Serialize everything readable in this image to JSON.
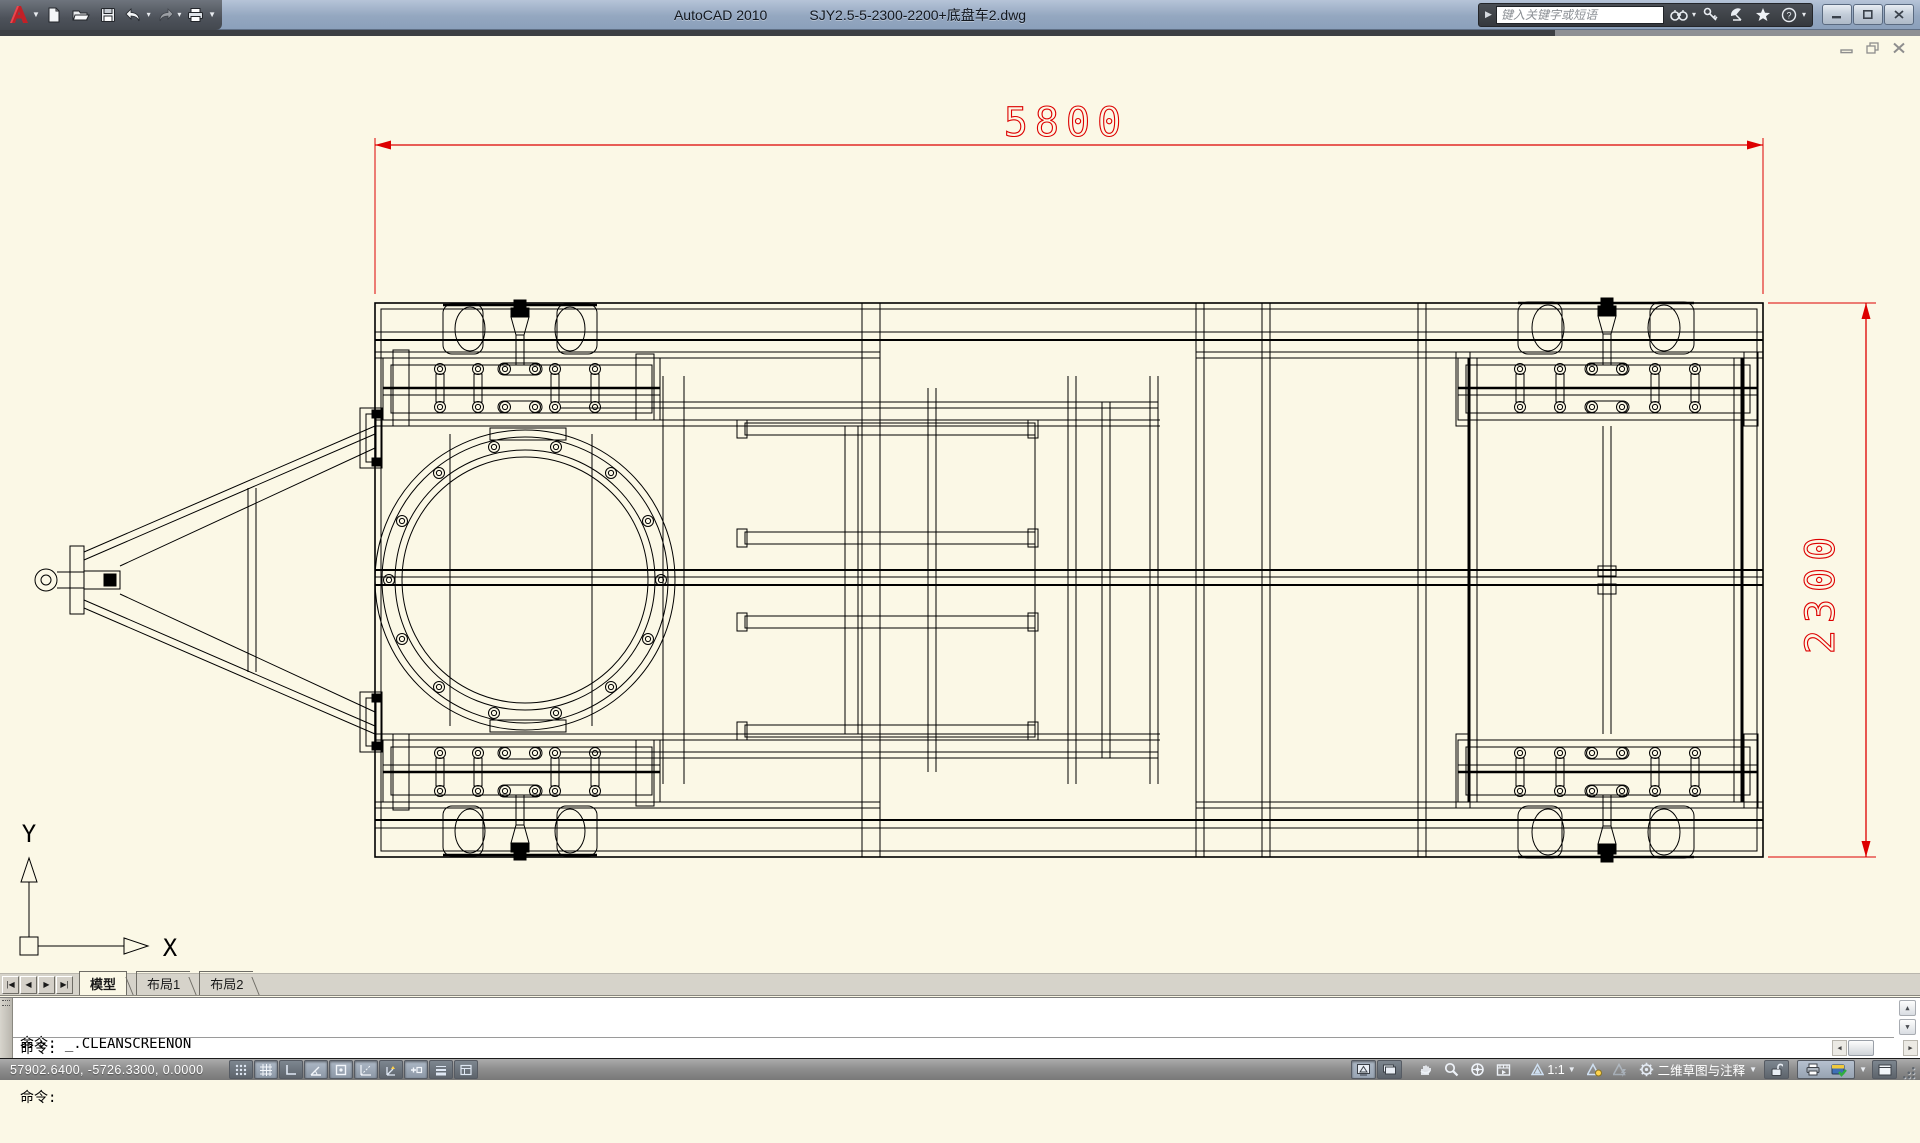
{
  "titlebar": {
    "app_title": "AutoCAD 2010",
    "doc_title": "SJY2.5-5-2300-2200+底盘车2.dwg",
    "qat_icons": [
      "autocad-logo",
      "menu-dropdown",
      "new-file",
      "open-file",
      "save",
      "undo",
      "redo",
      "plot",
      "qat-customize"
    ],
    "infocenter": {
      "search_placeholder": "键入关键字或短语",
      "icons": [
        "search-binoculars",
        "subscription-key",
        "communication-center",
        "favorites-star",
        "help"
      ]
    },
    "window_buttons": [
      "minimize",
      "maximize",
      "close"
    ]
  },
  "document_window": {
    "buttons": [
      "minimize",
      "restore",
      "close"
    ]
  },
  "drawing": {
    "dim_length": "5800",
    "dim_width": "2300",
    "dimension_color": "#dd0000",
    "ucs": {
      "x": "X",
      "y": "Y"
    }
  },
  "layout_tabs": {
    "nav_icons": [
      "first-tab",
      "previous-tab",
      "next-tab",
      "last-tab"
    ],
    "items": [
      {
        "label": "模型",
        "active": true
      },
      {
        "label": "布局1",
        "active": false
      },
      {
        "label": "布局2",
        "active": false
      }
    ]
  },
  "command_line": {
    "history": [
      "命令: _.CLEANSCREENON",
      "命令:"
    ],
    "prompt": "命令:"
  },
  "status_bar": {
    "coordinates": "57902.6400, -5726.3300, 0.0000",
    "toggles": [
      {
        "name": "snap",
        "on": false
      },
      {
        "name": "grid",
        "on": true
      },
      {
        "name": "ortho",
        "on": false
      },
      {
        "name": "polar",
        "on": true
      },
      {
        "name": "osnap",
        "on": true
      },
      {
        "name": "otrack",
        "on": true
      },
      {
        "name": "ducs",
        "on": false
      },
      {
        "name": "dyn",
        "on": true
      },
      {
        "name": "lwt",
        "on": false
      },
      {
        "name": "qp",
        "on": false
      }
    ],
    "model_layout": [
      "model",
      "layout"
    ],
    "nav_icons": [
      "pan-hand",
      "zoom-magnifier",
      "steering-wheel",
      "showmotion"
    ],
    "annotation_scale": "1:1",
    "annotation_icons": [
      "annotation-visibility",
      "annotation-auto"
    ],
    "workspace_label": "二维草图与注释",
    "right_icons": [
      "workspace-lock",
      "toolbar-unlock-group",
      "cleanscreen",
      "resize-grip"
    ]
  }
}
